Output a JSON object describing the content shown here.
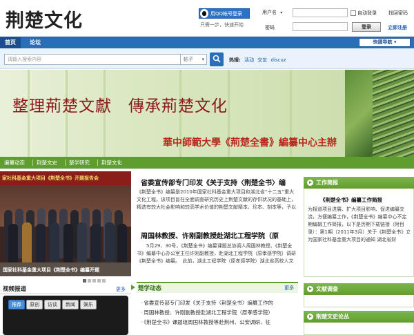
{
  "header": {
    "logo_text": "荆楚文化",
    "qq_login": "用QQ帐号登录",
    "qq_hint": "只需一步，快速开始",
    "username_select": "用户名",
    "remember": "自动登录",
    "find_password": "找回密码",
    "password_label": "密码",
    "login_button": "登录",
    "register": "立即注册"
  },
  "nav": {
    "items": [
      "首页",
      "论坛"
    ],
    "quick_nav": "快捷导航"
  },
  "search": {
    "placeholder": "请输入搜索内容",
    "type": "帖子",
    "hot_label": "热搜:",
    "hot_terms": [
      "活动",
      "交友",
      "discuz"
    ]
  },
  "banner": {
    "title": "整理荊楚文獻　傳承荊楚文化",
    "subtitle": "華中師範大學《荊楚全書》編纂中心主辦"
  },
  "subnav": {
    "items": [
      "编纂动态",
      "荆楚文史",
      "楚学研究",
      "荆楚文化"
    ]
  },
  "photo": {
    "banner_text": "家社科基金重大项目《荆楚全书》开题报告会",
    "caption": "国家社科基金重大项目《荆楚全书》编纂开题"
  },
  "news": [
    {
      "title": "省委宣传部专门印发《关于支持〈荆楚全书〉编",
      "body": "《荆楚全书》编纂是2010年国家社科基金重大项目和湖北省“十二五”重大文化工程。该项目旨在全面调查研究历史上荆楚文献的存供状况的基础上，精选有较大社会影响和较高学术价值的荆楚文献精本、珍本、刻本等，予以"
    },
    {
      "title": "周国林教授、许刚副教授赴湖北工程学院（原",
      "body": "5月29、30号，《荆楚全书》编纂课题总协调人周国林教授、《荆楚全书》编纂中心办公室主任许刚副教授，赴湖北工程学院（原孝感学院）调研《荆楚全书》编纂。　此前，湖北工程学院（原孝感学院）湖北省高校人文"
    }
  ],
  "video": {
    "title": "视频报道",
    "more": "更多",
    "tabs": [
      "推荐",
      "原创",
      "访谈",
      "新闻",
      "娱乐"
    ]
  },
  "chuxue": {
    "title": "楚学动态",
    "more": "更多",
    "items": [
      "省委宣传部专门印发《关于支持〈荆楚全书〉编纂工作的",
      "周国林教授、许刚副教授赴湖北工程学院（原孝感学院）",
      "《荆楚全书》课题组周国林教授等赴荆州、公安调研、征"
    ]
  },
  "sidebar": {
    "work_brief": {
      "head": "工作简报",
      "title": "《荆楚全书》编纂工作简报",
      "text": "为报道项目进展、扩大项目影响、促进编纂交流，方便编纂工作，《荆楚全书》编纂中心不定期编辑工作简报，以下是历期下载链接（附目录）：第1期（2011年3月）关于《荆楚全书》立为国家社科基金重大项目的通知 湖北省财"
    },
    "survey": {
      "head": "文献调查"
    },
    "forum": {
      "head": "荆楚文史论丛"
    }
  },
  "colors": {
    "nav_blue": "#2a6db8",
    "subnav_green": "#5f9d2e",
    "banner_red": "#8b1a1a"
  }
}
